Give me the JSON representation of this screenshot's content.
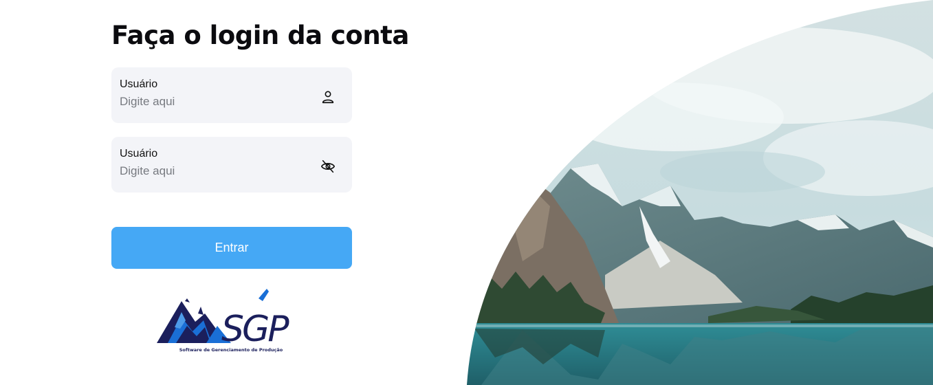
{
  "login": {
    "title": "Faça o login da conta",
    "user_field": {
      "label": "Usuário",
      "placeholder": "Digite aqui",
      "icon": "user-icon"
    },
    "password_field": {
      "label": "Usuário",
      "placeholder": "Digite aqui",
      "icon": "eye-off-icon"
    },
    "submit_label": "Entrar"
  },
  "logo": {
    "name": "SGP",
    "tagline": "Software de Gerenciamento de Produção"
  },
  "colors": {
    "accent": "#45a8f5",
    "field_bg": "#f3f4f8",
    "logo_dark": "#1b1f5c",
    "logo_blue": "#1a6fd6"
  }
}
